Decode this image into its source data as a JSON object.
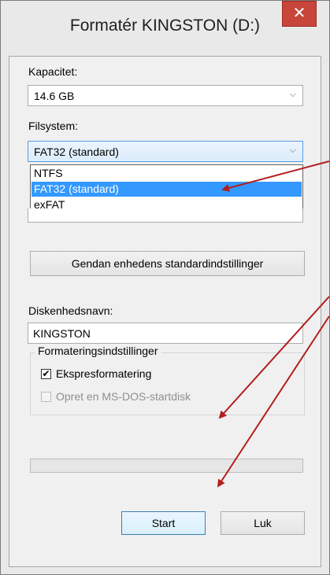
{
  "window": {
    "title": "Formatér KINGSTON (D:)",
    "close_glyph": "✕"
  },
  "capacity": {
    "label": "Kapacitet:",
    "value": "14.6 GB"
  },
  "filesystem": {
    "label": "Filsystem:",
    "value": "FAT32 (standard)",
    "options": [
      "NTFS",
      "FAT32 (standard)",
      "exFAT"
    ],
    "selected_index": 1
  },
  "restore_button": "Gendan enhedens standardindstillinger",
  "volume": {
    "label": "Diskenhedsnavn:",
    "value": "KINGSTON"
  },
  "format_options": {
    "title": "Formateringsindstillinger",
    "quick_format": {
      "label": "Ekspresformatering",
      "checked": true
    },
    "msdos_startup": {
      "label": "Opret en MS-DOS-startdisk",
      "checked": false,
      "disabled": true
    }
  },
  "progress": {
    "value": 0
  },
  "buttons": {
    "start": "Start",
    "close": "Luk"
  },
  "colors": {
    "close_button": "#c7453a",
    "selection": "#3399ff",
    "annotation_arrow": "#b21e1e"
  },
  "icons": {
    "dropdown": "chevron-down-icon",
    "close": "close-icon",
    "check": "checkmark-icon"
  }
}
